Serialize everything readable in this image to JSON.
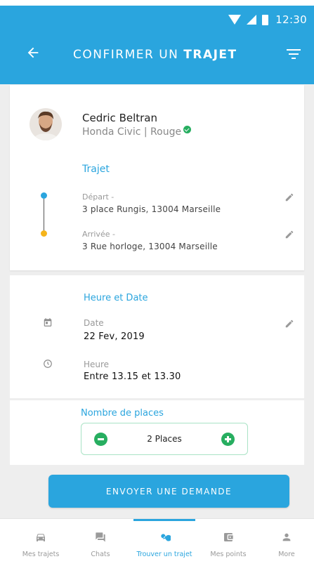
{
  "status_bar": {
    "time": "12:30"
  },
  "header": {
    "title_prefix": "CONFIRMER UN ",
    "title_bold": "TRAJET"
  },
  "driver": {
    "name": "Cedric Beltran",
    "car_model": "Honda Civic",
    "car_separator": " | ",
    "car_color": "Rouge"
  },
  "trajet": {
    "section_title": "Trajet",
    "depart_label": "Départ -",
    "depart_address": "3 place Rungis, 13004 Marseille",
    "arrivee_label": "Arrivée -",
    "arrivee_address": "3 Rue horloge, 13004 Marseille"
  },
  "schedule": {
    "section_title": "Heure et Date",
    "date_label": "Date",
    "date_value": "22 Fev, 2019",
    "time_label": "Heure",
    "time_value": "Entre 13.15 et 13.30"
  },
  "places": {
    "section_title": "Nombre de places",
    "value": "2 Places"
  },
  "send_button": {
    "label": "ENVOYER UNE DEMANDE"
  },
  "bottom_nav": {
    "items": [
      {
        "label": "Mes trajets",
        "icon": "car-icon",
        "active": false
      },
      {
        "label": "Chats",
        "icon": "chat-icon",
        "active": false
      },
      {
        "label": "Trouver un trajet",
        "icon": "search-icon",
        "active": true
      },
      {
        "label": "Mes points",
        "icon": "wallet-icon",
        "active": false
      },
      {
        "label": "More",
        "icon": "person-icon",
        "active": false
      }
    ]
  },
  "colors": {
    "primary": "#2aa5de",
    "success": "#27ae60",
    "depart_dot": "#2aa5de",
    "arrivee_dot": "#f5b41a"
  }
}
